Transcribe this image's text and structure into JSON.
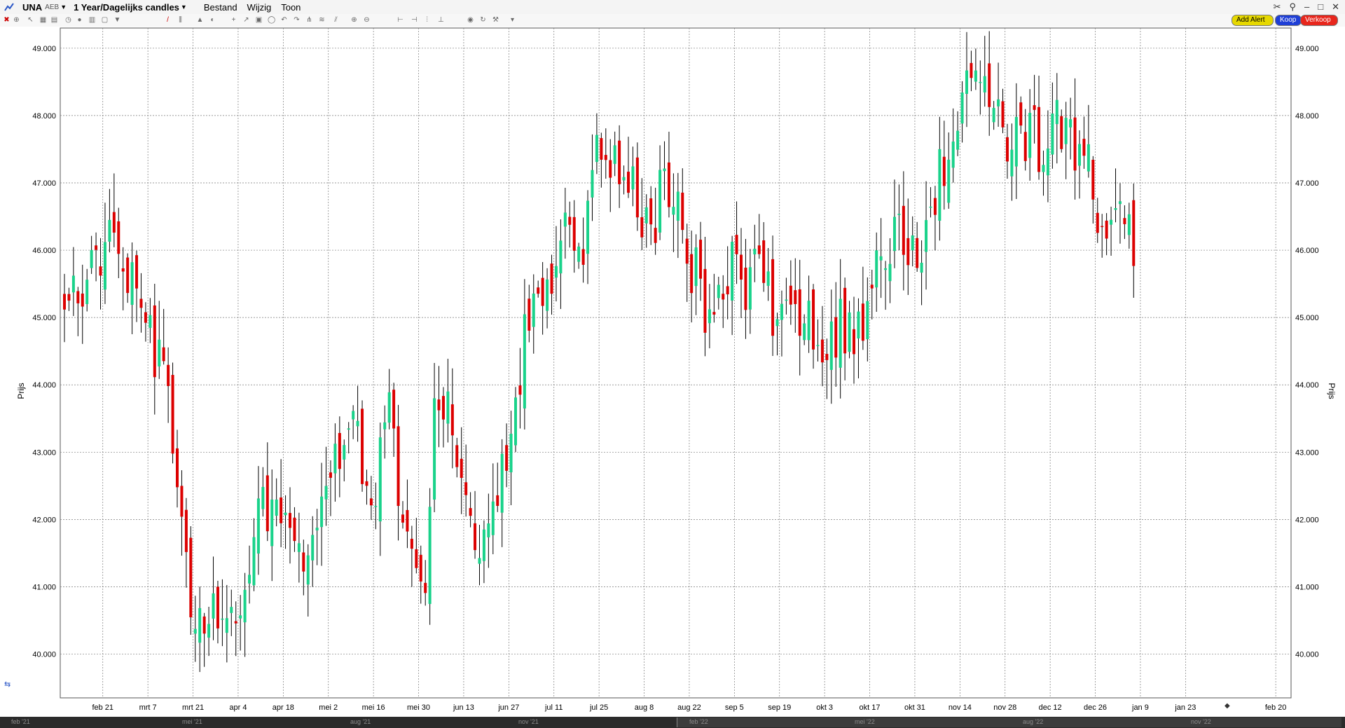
{
  "toolbar": {
    "symbol": "UNA",
    "exchange": "AEB",
    "period": "1 Year/Dagelijks candles",
    "menus": [
      "Bestand",
      "Wijzig",
      "Toon"
    ],
    "add_alert": "Add Alert",
    "buy": "Koop",
    "sell": "Verkoop"
  },
  "navigator": {
    "labels": [
      "feb '21",
      "mei '21",
      "aug '21",
      "nov '21",
      "feb '22",
      "mei '22",
      "aug '22",
      "nov '22"
    ]
  },
  "colors": {
    "up": "#19d28a",
    "down": "#dc0000",
    "wick": "#000000",
    "grid": "#7a7a7a"
  },
  "chart_data": {
    "type": "candlestick",
    "ylabel": "Prijs",
    "ylim": [
      39.35,
      49.3
    ],
    "y_ticks": [
      "49.000",
      "48.000",
      "47.000",
      "46.000",
      "45.000",
      "44.000",
      "43.000",
      "42.000",
      "41.000",
      "40.000"
    ],
    "y_tick_values": [
      49,
      48,
      47,
      46,
      45,
      44,
      43,
      42,
      41,
      40
    ],
    "x_ticks": [
      "feb 21",
      "mrt 7",
      "mrt 21",
      "apr 4",
      "apr 18",
      "mei 2",
      "mei 16",
      "mei 30",
      "jun 13",
      "jun 27",
      "jul 11",
      "jul 25",
      "aug 8",
      "aug 22",
      "sep 5",
      "sep 19",
      "okt 3",
      "okt 17",
      "okt 31",
      "nov 14",
      "nov 28",
      "dec 12",
      "dec 26",
      "jan 9",
      "jan 23",
      "feb 20"
    ],
    "anchor_points": [
      [
        0,
        45.3
      ],
      [
        10,
        46.0
      ],
      [
        15,
        45.6
      ],
      [
        18,
        45.0
      ],
      [
        21,
        44.3
      ],
      [
        24,
        43.3
      ],
      [
        26,
        42.0
      ],
      [
        28,
        40.8
      ],
      [
        32,
        40.7
      ],
      [
        36,
        40.6
      ],
      [
        40,
        41.1
      ],
      [
        44,
        42.2
      ],
      [
        48,
        42.3
      ],
      [
        52,
        41.6
      ],
      [
        56,
        41.7
      ],
      [
        60,
        42.7
      ],
      [
        63,
        43.7
      ],
      [
        66,
        42.8
      ],
      [
        69,
        42.4
      ],
      [
        72,
        43.9
      ],
      [
        75,
        41.8
      ],
      [
        78,
        41.2
      ],
      [
        80,
        41.0
      ],
      [
        82,
        44.2
      ],
      [
        85,
        43.5
      ],
      [
        88,
        42.6
      ],
      [
        91,
        41.9
      ],
      [
        94,
        41.7
      ],
      [
        96,
        42.4
      ],
      [
        99,
        43.5
      ],
      [
        102,
        44.6
      ],
      [
        105,
        45.3
      ],
      [
        108,
        45.8
      ],
      [
        111,
        46.2
      ],
      [
        114,
        45.7
      ],
      [
        116,
        46.6
      ],
      [
        118,
        47.5
      ],
      [
        121,
        47.3
      ],
      [
        124,
        47.3
      ],
      [
        127,
        46.6
      ],
      [
        130,
        46.3
      ],
      [
        133,
        47.0
      ],
      [
        136,
        46.8
      ],
      [
        139,
        45.8
      ],
      [
        142,
        45.2
      ],
      [
        145,
        45.2
      ],
      [
        148,
        45.7
      ],
      [
        151,
        45.1
      ],
      [
        154,
        45.9
      ],
      [
        157,
        45.1
      ],
      [
        160,
        45.0
      ],
      [
        163,
        45.1
      ],
      [
        166,
        44.9
      ],
      [
        169,
        44.7
      ],
      [
        172,
        44.9
      ],
      [
        175,
        44.6
      ],
      [
        178,
        45.1
      ],
      [
        181,
        46.0
      ],
      [
        184,
        46.3
      ],
      [
        187,
        45.8
      ],
      [
        190,
        46.2
      ],
      [
        193,
        46.8
      ],
      [
        196,
        47.6
      ],
      [
        199,
        48.3
      ],
      [
        202,
        48.6
      ],
      [
        205,
        48.0
      ],
      [
        208,
        47.7
      ],
      [
        211,
        47.6
      ],
      [
        214,
        47.8
      ],
      [
        217,
        47.4
      ],
      [
        220,
        47.9
      ],
      [
        223,
        47.5
      ],
      [
        226,
        47.4
      ],
      [
        229,
        46.6
      ],
      [
        232,
        46.1
      ],
      [
        235,
        46.6
      ],
      [
        237,
        46.2
      ]
    ],
    "n_days": 238,
    "rng_seed": 20230210
  }
}
